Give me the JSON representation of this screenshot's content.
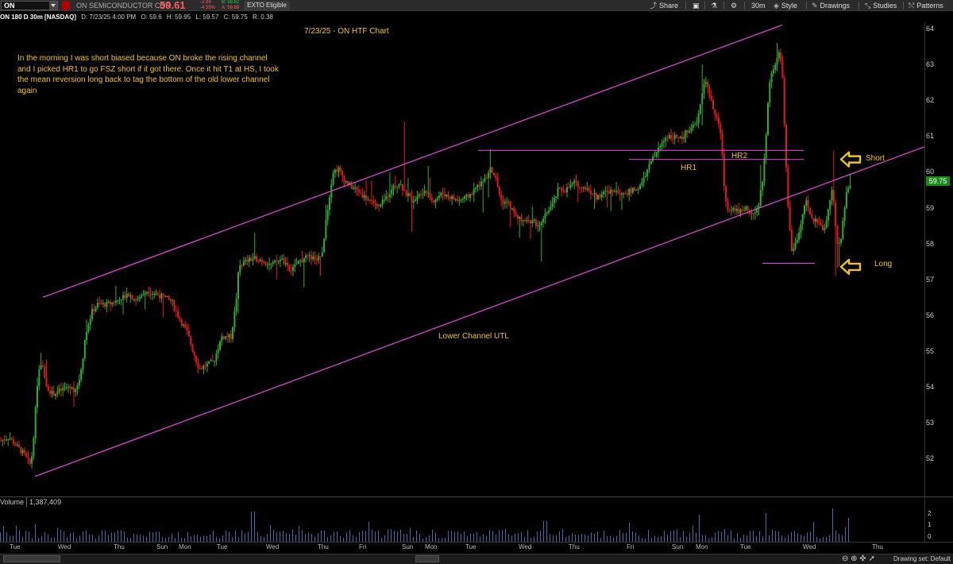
{
  "toolbar": {
    "symbol": "ON",
    "company": "ON SEMICONDUCTOR COR",
    "last_price": "59.61",
    "change": "-2.84",
    "change_pct": "-4.55%",
    "bid": "B: 59.62",
    "ask": "A: 59.89",
    "extended_badge": "EXTO Eligible",
    "share_label": "Share",
    "timeframe_label": "30m",
    "style_label": "Style",
    "drawings_label": "Drawings",
    "studies_label": "Studies",
    "patterns_label": "Patterns"
  },
  "chart_header": {
    "symbol_desc": "ON 180 D 30m [NASDAQ]",
    "date": "D: 7/23/25 4:00 PM",
    "open": "O: 59.6",
    "high": "H: 59.95",
    "low": "L: 59.57",
    "close": "C: 59.75",
    "range": "R: 0.38"
  },
  "annotations": {
    "title": "7/23/25 - ON HTF Chart",
    "note": "In the morning I was short biased because ON broke the rising channel and I picked HR1 to go FSZ short if it got there. Once it hit T1 at HS, I took the mean reversion long back to tag the bottom of the old lower channel again",
    "hr1": "HR1",
    "hr2": "HR2",
    "lower_channel": "Lower Channel UTL",
    "short": "Short",
    "long": "Long"
  },
  "price_axis": {
    "ticks": [
      "64",
      "63",
      "62",
      "61",
      "60",
      "59",
      "58",
      "57",
      "56",
      "55",
      "54",
      "53",
      "52"
    ],
    "last_label": "59.75"
  },
  "volume_panel": {
    "title": "Volume",
    "value": "1,387,409",
    "axis_ticks": [
      "2",
      "1",
      "0"
    ]
  },
  "time_axis": [
    "Tue",
    "Wed",
    "Thu",
    "Sun",
    "Mon",
    "Tue",
    "Wed",
    "Thu",
    "Fri",
    "Sun",
    "Mon",
    "Tue",
    "Wed",
    "Thu",
    "Fri",
    "Sun",
    "Mon",
    "Tue",
    "Wed",
    "Thu"
  ],
  "bottom_bar": {
    "drawing_set": "Drawing set: Default"
  },
  "chart_data": {
    "type": "candlestick",
    "ylim": [
      51.4,
      64.1
    ],
    "colors": {
      "up": "#2fae2f",
      "down": "#e81818",
      "channel": "#d14cc8",
      "annotation": "#f0c419"
    },
    "path": [
      [
        0,
        52.5
      ],
      [
        10,
        52.6
      ],
      [
        22,
        52.3
      ],
      [
        30,
        52.1
      ],
      [
        38,
        51.8
      ],
      [
        42,
        52.8
      ],
      [
        47,
        54.4
      ],
      [
        52,
        54.6
      ],
      [
        58,
        54.0
      ],
      [
        65,
        53.8
      ],
      [
        75,
        53.9
      ],
      [
        85,
        54.0
      ],
      [
        95,
        53.9
      ],
      [
        100,
        54.3
      ],
      [
        108,
        55.6
      ],
      [
        115,
        56.1
      ],
      [
        122,
        56.3
      ],
      [
        135,
        56.3
      ],
      [
        145,
        56.4
      ],
      [
        160,
        56.6
      ],
      [
        172,
        56.4
      ],
      [
        182,
        56.7
      ],
      [
        195,
        56.6
      ],
      [
        205,
        56.5
      ],
      [
        215,
        56.4
      ],
      [
        225,
        55.9
      ],
      [
        235,
        55.5
      ],
      [
        242,
        55.0
      ],
      [
        250,
        54.5
      ],
      [
        258,
        54.6
      ],
      [
        268,
        54.7
      ],
      [
        278,
        55.4
      ],
      [
        290,
        55.4
      ],
      [
        296,
        56.3
      ],
      [
        300,
        57.4
      ],
      [
        308,
        57.5
      ],
      [
        320,
        57.6
      ],
      [
        332,
        57.5
      ],
      [
        342,
        57.4
      ],
      [
        352,
        57.6
      ],
      [
        365,
        57.2
      ],
      [
        375,
        57.5
      ],
      [
        385,
        57.6
      ],
      [
        398,
        57.6
      ],
      [
        405,
        57.7
      ],
      [
        410,
        58.7
      ],
      [
        418,
        60.0
      ],
      [
        425,
        60.1
      ],
      [
        432,
        59.8
      ],
      [
        440,
        59.6
      ],
      [
        448,
        59.5
      ],
      [
        458,
        59.3
      ],
      [
        466,
        59.2
      ],
      [
        476,
        59.0
      ],
      [
        486,
        59.3
      ],
      [
        494,
        59.6
      ],
      [
        502,
        59.7
      ],
      [
        510,
        59.4
      ],
      [
        518,
        59.2
      ],
      [
        526,
        59.4
      ],
      [
        534,
        59.5
      ],
      [
        544,
        59.2
      ],
      [
        556,
        59.4
      ],
      [
        566,
        59.3
      ],
      [
        576,
        59.2
      ],
      [
        588,
        59.3
      ],
      [
        600,
        59.6
      ],
      [
        610,
        59.8
      ],
      [
        616,
        60.1
      ],
      [
        622,
        59.9
      ],
      [
        630,
        59.2
      ],
      [
        640,
        59.1
      ],
      [
        650,
        58.7
      ],
      [
        660,
        58.7
      ],
      [
        670,
        58.6
      ],
      [
        680,
        58.5
      ],
      [
        688,
        58.9
      ],
      [
        695,
        59.1
      ],
      [
        702,
        59.5
      ],
      [
        712,
        59.5
      ],
      [
        722,
        59.7
      ],
      [
        730,
        59.6
      ],
      [
        740,
        59.5
      ],
      [
        750,
        59.3
      ],
      [
        760,
        59.4
      ],
      [
        772,
        59.5
      ],
      [
        785,
        59.4
      ],
      [
        798,
        59.5
      ],
      [
        806,
        59.6
      ],
      [
        815,
        60.1
      ],
      [
        822,
        60.4
      ],
      [
        830,
        60.7
      ],
      [
        838,
        61.0
      ],
      [
        846,
        61.0
      ],
      [
        856,
        60.9
      ],
      [
        866,
        61.2
      ],
      [
        876,
        61.3
      ],
      [
        882,
        62.0
      ],
      [
        886,
        62.6
      ],
      [
        890,
        62.4
      ],
      [
        896,
        61.8
      ],
      [
        902,
        61.5
      ],
      [
        908,
        60.8
      ],
      [
        910,
        59.8
      ],
      [
        914,
        59.0
      ],
      [
        922,
        59.0
      ],
      [
        930,
        58.9
      ],
      [
        938,
        59.0
      ],
      [
        948,
        58.8
      ],
      [
        954,
        59.0
      ],
      [
        960,
        59.9
      ],
      [
        964,
        61.2
      ],
      [
        968,
        62.5
      ],
      [
        974,
        63.0
      ],
      [
        980,
        63.3
      ],
      [
        984,
        62.8
      ],
      [
        988,
        60.5
      ],
      [
        992,
        58.7
      ],
      [
        996,
        57.8
      ],
      [
        1002,
        58.0
      ],
      [
        1008,
        58.6
      ],
      [
        1014,
        59.2
      ],
      [
        1020,
        58.7
      ],
      [
        1028,
        58.6
      ],
      [
        1036,
        58.4
      ],
      [
        1042,
        58.9
      ],
      [
        1047,
        59.6
      ],
      [
        1050,
        58.8
      ],
      [
        1054,
        57.9
      ],
      [
        1058,
        58.2
      ],
      [
        1062,
        59.0
      ],
      [
        1066,
        59.5
      ],
      [
        1070,
        59.7
      ]
    ],
    "channel_lines": [
      {
        "label": "upper channel",
        "x1": 54,
        "y1": 56.5,
        "x2": 985,
        "y2": 64.1
      },
      {
        "label": "Lower Channel UTL",
        "x1": 44,
        "y1": 51.5,
        "x2": 1164,
        "y2": 60.7
      }
    ],
    "resistance_lines": [
      {
        "label": "HR2",
        "x1": 602,
        "x2": 1012,
        "y": 60.6
      },
      {
        "label": "HR1",
        "x1": 792,
        "x2": 1012,
        "y": 60.35
      },
      {
        "label": "low",
        "x1": 960,
        "x2": 1026,
        "y": 57.45
      }
    ],
    "markers": [
      {
        "label": "Short",
        "x": 1072,
        "y": 60.35
      },
      {
        "label": "Long",
        "x": 1072,
        "y": 57.35
      }
    ]
  }
}
